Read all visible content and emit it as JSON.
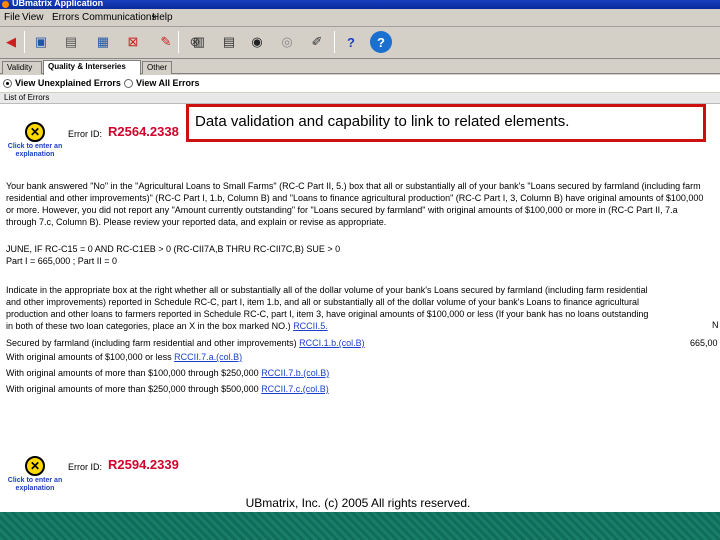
{
  "window": {
    "title": "UBmatrix Application"
  },
  "menu": {
    "items": [
      {
        "label": "File"
      },
      {
        "label": "View"
      },
      {
        "label": "Errors"
      },
      {
        "label": "Communications"
      },
      {
        "label": "Help"
      }
    ]
  },
  "toolbar": {
    "buttons": [
      {
        "icon": "back-arrow-icon"
      },
      {
        "icon": "save-icon"
      },
      {
        "icon": "print-icon"
      },
      {
        "icon": "grid-icon"
      },
      {
        "icon": "delete-grid-icon"
      },
      {
        "icon": "edit-icon"
      },
      {
        "icon": "delete-icon"
      },
      {
        "icon": "calculator-icon"
      },
      {
        "icon": "notes-icon"
      },
      {
        "icon": "camera-icon"
      },
      {
        "icon": "disc-icon"
      },
      {
        "icon": "pencil-icon"
      },
      {
        "icon": "help-icon"
      },
      {
        "icon": "help-circle-icon"
      }
    ]
  },
  "tabs": [
    {
      "label": "Validity"
    },
    {
      "label": "Quality & Interseries"
    },
    {
      "label": "Other"
    }
  ],
  "filter": {
    "unexplained": "View Unexplained Errors",
    "all": "View All Errors"
  },
  "list_label": "List of Errors",
  "callout": "Data validation and capability to link to related elements.",
  "errors": [
    {
      "explain": "Click to enter an explanation",
      "id_label": "Error ID:",
      "id": "R2564.2338"
    },
    {
      "explain": "Click to enter an explanation",
      "id_label": "Error ID:",
      "id": "R2594.2339"
    }
  ],
  "body": {
    "p1": "Your bank answered \"No\" in the \"Agricultural Loans to Small Farms\" (RC-C Part II, 5.) box that all or substantially all of your bank's \"Loans secured by farmland (including farm residential and other improvements)\" (RC-C Part I, 1.b, Column B) and \"Loans to finance agricultural production\" (RC-C Part I, 3, Column B) have original amounts of $100,000 or more. However, you did not report any \"Amount currently outstanding\" for \"Loans secured by farmland\" with original amounts of $100,000 or more in (RC-C Part II, 7.a through 7.c, Column B). Please review your reported data, and explain or revise as appropriate.",
    "p2": "JUNE, IF RC-C15 = 0 AND RC-C1EB > 0 (RC-CII7A,B THRU RC-CII7C,B) SUE > 0",
    "p3": "Part I = 665,000 ; Part II = 0",
    "p4": "Indicate in the appropriate box at the right whether all or substantially all of the dollar volume of your bank's Loans secured by farmland (including farm residential and other improvements) reported in Schedule RC-C, part I, item 1.b, and all or substantially all of the dollar volume of your bank's Loans to finance agricultural production and other loans to farmers reported in Schedule RC-C, part I, item 3, have original amounts of $100,000 or less (If your bank has no loans outstanding in both of these two loan categories, place an X in the box marked NO.)",
    "link_1": "RCCII.5.",
    "right_1": "N",
    "line_secured": "Secured by farmland (including farm residential and other improvements)",
    "link_2": "RCCI.1.b.(col.B)",
    "right_2": "665,00",
    "line_a": "With original amounts of $100,000 or less",
    "link_a": "RCCII.7.a.(col.B)",
    "line_b": "With original amounts of more than $100,000 through $250,000",
    "link_b": "RCCII.7.b.(col.B)",
    "line_c": "With original amounts of more than $250,000 through $500,000",
    "link_c": "RCCII.7.c.(col.B)"
  },
  "footer": {
    "copyright": "UBmatrix, Inc. (c) 2005 All rights reserved."
  }
}
